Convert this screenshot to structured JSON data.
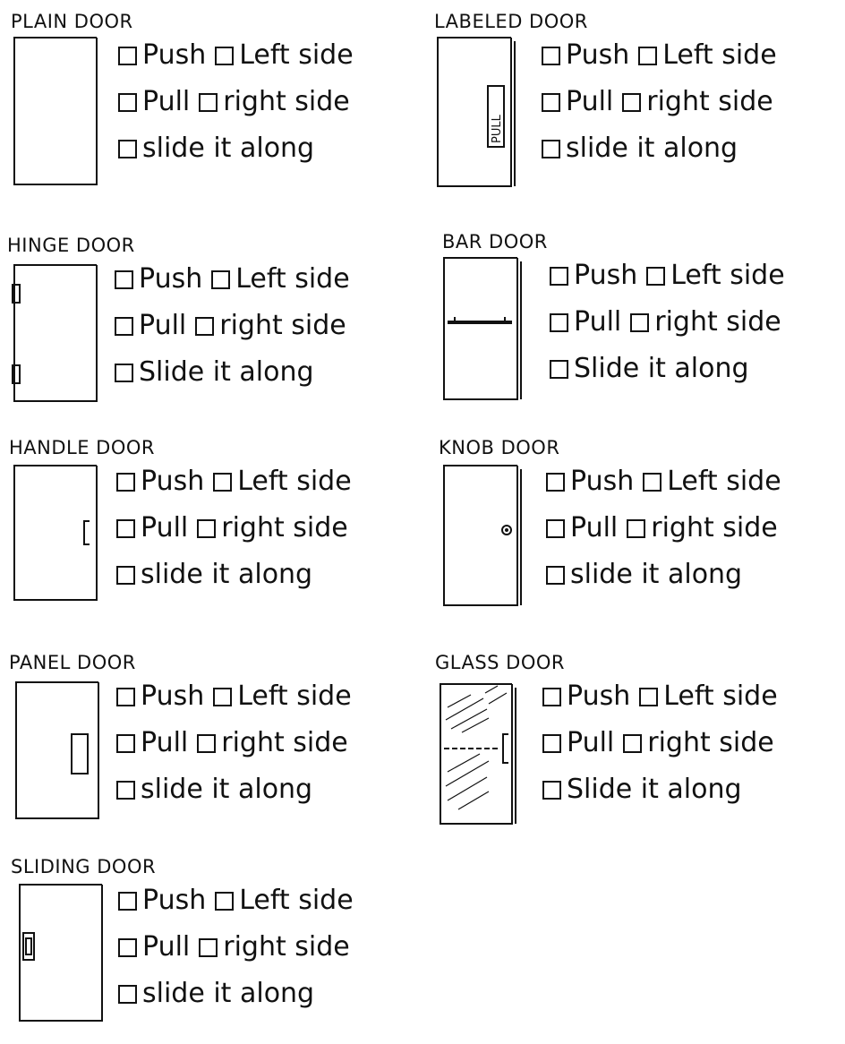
{
  "sections": [
    {
      "title": "Plain door",
      "door": "plain",
      "options": {
        "push": "Push",
        "left": "Left side",
        "pull": "Pull",
        "right": "right side",
        "slide": "slide it along"
      }
    },
    {
      "title": "Labeled door",
      "door": "labeled",
      "door_label": "PULL",
      "options": {
        "push": "Push",
        "left": "Left side",
        "pull": "Pull",
        "right": "right side",
        "slide": "slide it along"
      }
    },
    {
      "title": "Hinge door",
      "door": "hinge",
      "options": {
        "push": "Push",
        "left": "Left side",
        "pull": "Pull",
        "right": "right side",
        "slide": "Slide it along"
      }
    },
    {
      "title": "Bar door",
      "door": "bar",
      "options": {
        "push": "Push",
        "left": "Left side",
        "pull": "Pull",
        "right": "right side",
        "slide": "Slide it along"
      }
    },
    {
      "title": "Handle door",
      "door": "handle",
      "options": {
        "push": "Push",
        "left": "Left side",
        "pull": "Pull",
        "right": "right side",
        "slide": "slide it along"
      }
    },
    {
      "title": "Knob door",
      "door": "knob",
      "options": {
        "push": "Push",
        "left": "Left side",
        "pull": "Pull",
        "right": "right side",
        "slide": "slide it along"
      }
    },
    {
      "title": "Panel door",
      "door": "panel",
      "options": {
        "push": "Push",
        "left": "Left side",
        "pull": "Pull",
        "right": "right side",
        "slide": "slide it along"
      }
    },
    {
      "title": "Glass door",
      "door": "glass",
      "options": {
        "push": "Push",
        "left": "Left side",
        "pull": "Pull",
        "right": "right side",
        "slide": "Slide it along"
      }
    },
    {
      "title": "Sliding door",
      "door": "sliding",
      "options": {
        "push": "Push",
        "left": "Left side",
        "pull": "Pull",
        "right": "right side",
        "slide": "slide it along"
      }
    }
  ]
}
